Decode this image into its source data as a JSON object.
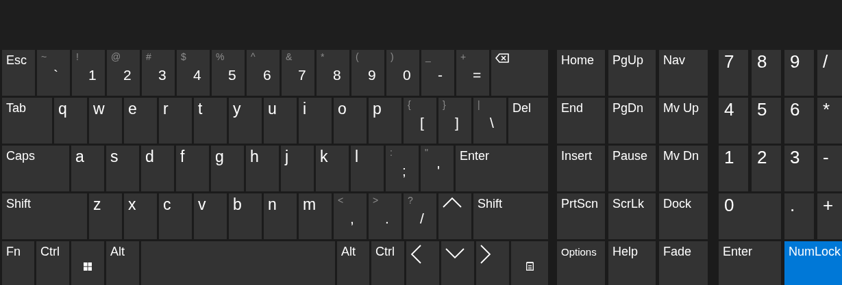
{
  "main_keys": [
    [
      {
        "kind": "text",
        "label": "Esc"
      },
      {
        "kind": "dual",
        "shift": "~",
        "label": "`"
      },
      {
        "kind": "dual",
        "shift": "!",
        "label": "1"
      },
      {
        "kind": "dual",
        "shift": "@",
        "label": "2"
      },
      {
        "kind": "dual",
        "shift": "#",
        "label": "3"
      },
      {
        "kind": "dual",
        "shift": "$",
        "label": "4"
      },
      {
        "kind": "dual",
        "shift": "%",
        "label": "5"
      },
      {
        "kind": "dual",
        "shift": "^",
        "label": "6"
      },
      {
        "kind": "dual",
        "shift": "&",
        "label": "7"
      },
      {
        "kind": "dual",
        "shift": "*",
        "label": "8"
      },
      {
        "kind": "dual",
        "shift": "(",
        "label": "9"
      },
      {
        "kind": "dual",
        "shift": ")",
        "label": "0"
      },
      {
        "kind": "dual",
        "shift": "_",
        "label": "-"
      },
      {
        "kind": "dual",
        "shift": "+",
        "label": "="
      },
      {
        "kind": "backspace"
      }
    ],
    [
      {
        "kind": "text",
        "label": "Tab"
      },
      {
        "kind": "letter",
        "label": "q"
      },
      {
        "kind": "letter",
        "label": "w"
      },
      {
        "kind": "letter",
        "label": "e"
      },
      {
        "kind": "letter",
        "label": "r"
      },
      {
        "kind": "letter",
        "label": "t"
      },
      {
        "kind": "letter",
        "label": "y"
      },
      {
        "kind": "letter",
        "label": "u"
      },
      {
        "kind": "letter",
        "label": "i"
      },
      {
        "kind": "letter",
        "label": "o"
      },
      {
        "kind": "letter",
        "label": "p"
      },
      {
        "kind": "dual",
        "shift": "{",
        "label": "["
      },
      {
        "kind": "dual",
        "shift": "}",
        "label": "]"
      },
      {
        "kind": "dual",
        "shift": "|",
        "label": "\\"
      },
      {
        "kind": "text",
        "label": "Del"
      }
    ],
    [
      {
        "kind": "toggle",
        "label": "Caps",
        "on": false
      },
      {
        "kind": "letter",
        "label": "a"
      },
      {
        "kind": "letter",
        "label": "s"
      },
      {
        "kind": "letter",
        "label": "d"
      },
      {
        "kind": "letter",
        "label": "f"
      },
      {
        "kind": "letter",
        "label": "g"
      },
      {
        "kind": "letter",
        "label": "h"
      },
      {
        "kind": "letter",
        "label": "j"
      },
      {
        "kind": "letter",
        "label": "k"
      },
      {
        "kind": "letter",
        "label": "l"
      },
      {
        "kind": "dual",
        "shift": ":",
        "label": ";"
      },
      {
        "kind": "dual",
        "shift": "\"",
        "label": "'"
      },
      {
        "kind": "text",
        "label": "Enter"
      }
    ],
    [
      {
        "kind": "text",
        "label": "Shift"
      },
      {
        "kind": "letter",
        "label": "z"
      },
      {
        "kind": "letter",
        "label": "x"
      },
      {
        "kind": "letter",
        "label": "c"
      },
      {
        "kind": "letter",
        "label": "v"
      },
      {
        "kind": "letter",
        "label": "b"
      },
      {
        "kind": "letter",
        "label": "n"
      },
      {
        "kind": "letter",
        "label": "m"
      },
      {
        "kind": "dual",
        "shift": "<",
        "label": ","
      },
      {
        "kind": "dual",
        "shift": ">",
        "label": "."
      },
      {
        "kind": "dual",
        "shift": "?",
        "label": "/"
      },
      {
        "kind": "up"
      },
      {
        "kind": "text",
        "label": "Shift"
      }
    ],
    [
      {
        "kind": "text",
        "label": "Fn"
      },
      {
        "kind": "text",
        "label": "Ctrl"
      },
      {
        "kind": "windows"
      },
      {
        "kind": "text",
        "label": "Alt"
      },
      {
        "kind": "space"
      },
      {
        "kind": "text",
        "label": "Alt"
      },
      {
        "kind": "text",
        "label": "Ctrl"
      },
      {
        "kind": "left"
      },
      {
        "kind": "down"
      },
      {
        "kind": "right"
      },
      {
        "kind": "menu"
      }
    ]
  ],
  "nav_keys": [
    [
      {
        "kind": "text",
        "label": "Home"
      },
      {
        "kind": "text",
        "label": "PgUp"
      },
      {
        "kind": "text",
        "label": "Nav"
      }
    ],
    [
      {
        "kind": "text",
        "label": "End"
      },
      {
        "kind": "text",
        "label": "PgDn"
      },
      {
        "kind": "text",
        "label": "Mv Up"
      }
    ],
    [
      {
        "kind": "text",
        "label": "Insert"
      },
      {
        "kind": "text",
        "label": "Pause"
      },
      {
        "kind": "text",
        "label": "Mv Dn"
      }
    ],
    [
      {
        "kind": "text",
        "label": "PrtScn"
      },
      {
        "kind": "toggle",
        "label": "ScrLk",
        "on": false
      },
      {
        "kind": "text",
        "label": "Dock"
      }
    ],
    [
      {
        "kind": "small",
        "label": "Options"
      },
      {
        "kind": "text",
        "label": "Help"
      },
      {
        "kind": "text",
        "label": "Fade"
      }
    ]
  ],
  "numpad_keys": [
    [
      {
        "kind": "digit",
        "label": "7"
      },
      {
        "kind": "digit",
        "label": "8"
      },
      {
        "kind": "digit",
        "label": "9"
      },
      {
        "kind": "digit",
        "label": "/"
      }
    ],
    [
      {
        "kind": "digit",
        "label": "4"
      },
      {
        "kind": "digit",
        "label": "5"
      },
      {
        "kind": "digit",
        "label": "6"
      },
      {
        "kind": "digit",
        "label": "*"
      }
    ],
    [
      {
        "kind": "digit",
        "label": "1"
      },
      {
        "kind": "digit",
        "label": "2"
      },
      {
        "kind": "digit",
        "label": "3"
      },
      {
        "kind": "digit",
        "label": "-"
      }
    ],
    [
      {
        "kind": "digit",
        "label": "0"
      },
      {
        "kind": "digit",
        "label": "."
      },
      {
        "kind": "digit",
        "label": "+"
      }
    ],
    [
      {
        "kind": "text",
        "label": "Enter"
      },
      {
        "kind": "toggle",
        "label": "NumLock",
        "on": true
      }
    ]
  ]
}
